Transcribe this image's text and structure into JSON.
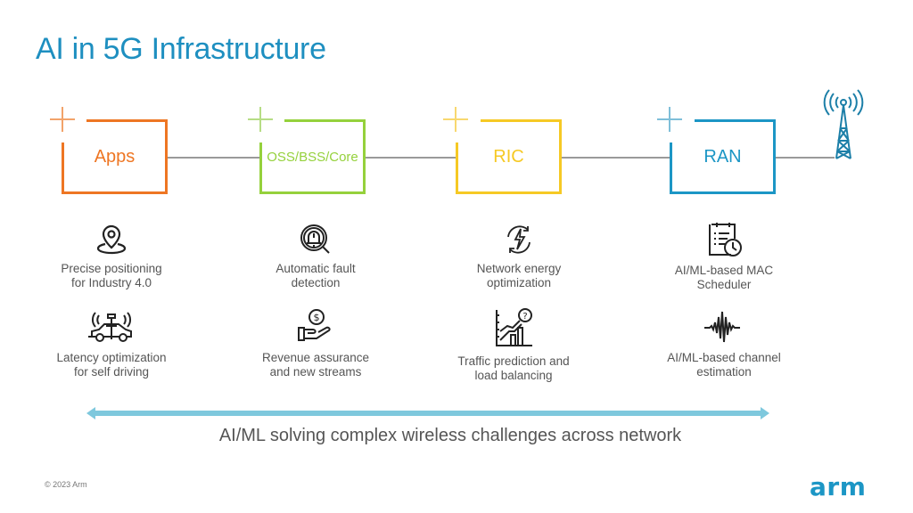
{
  "slide": {
    "title": "AI in 5G Infrastructure",
    "caption": "AI/ML solving complex wireless challenges across network",
    "copyright": "© 2023 Arm",
    "logo": "arm"
  },
  "colors": {
    "title": "#1e8fc0",
    "apps": "#ee7623",
    "oss": "#95d13c",
    "ric": "#f6c924",
    "ran": "#1c96c5",
    "connector": "#9a9a9a",
    "arrow": "#7ec8dd",
    "logo": "#1c96c5"
  },
  "stages": [
    {
      "label": "Apps",
      "icon": "plus-icon"
    },
    {
      "label": "OSS/BSS/Core",
      "icon": "plus-icon"
    },
    {
      "label": "RIC",
      "icon": "plus-icon"
    },
    {
      "label": "RAN",
      "icon": "plus-icon"
    }
  ],
  "endpoint": {
    "icon": "cell-tower-icon"
  },
  "use_cases": [
    {
      "column": "Apps",
      "items": [
        {
          "icon": "location-pin-icon",
          "label": "Precise positioning\nfor Industry 4.0"
        },
        {
          "icon": "self-driving-car-icon",
          "label": "Latency optimization\nfor self driving"
        }
      ]
    },
    {
      "column": "OSS/BSS/Core",
      "items": [
        {
          "icon": "alarm-search-icon",
          "label": "Automatic fault\ndetection"
        },
        {
          "icon": "money-hand-icon",
          "label": "Revenue assurance\nand new streams"
        }
      ]
    },
    {
      "column": "RIC",
      "items": [
        {
          "icon": "energy-cycle-icon",
          "label": "Network energy\noptimization"
        },
        {
          "icon": "traffic-chart-icon",
          "label": "Traffic prediction and\nload balancing"
        }
      ]
    },
    {
      "column": "RAN",
      "items": [
        {
          "icon": "schedule-clipboard-icon",
          "label": "AI/ML-based MAC\nScheduler"
        },
        {
          "icon": "waveform-icon",
          "label": "AI/ML-based channel\nestimation"
        }
      ]
    }
  ]
}
